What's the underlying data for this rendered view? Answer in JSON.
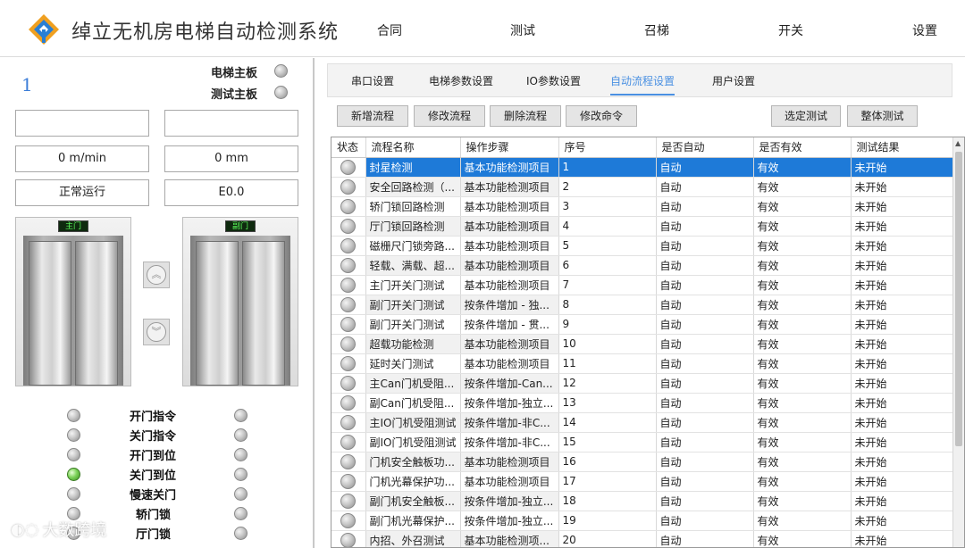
{
  "header": {
    "title": "绰立无机房电梯自动检测系统",
    "menu": [
      "合同",
      "测试",
      "召梯",
      "开关",
      "设置"
    ]
  },
  "left": {
    "elevator_number": "1",
    "boards": [
      {
        "label": "电梯主板",
        "state": "off"
      },
      {
        "label": "测试主板",
        "state": "off"
      }
    ],
    "fields": {
      "blank_left": "",
      "blank_right": "",
      "speed": "0 m/min",
      "position": "0 mm",
      "status": "正常运行",
      "error_code": "E0.0"
    },
    "cabins": [
      {
        "display": "主门",
        "name": "main"
      },
      {
        "display": "副门",
        "name": "sub"
      }
    ],
    "up_icon": "double-chevron-up-icon",
    "down_icon": "double-chevron-down-icon",
    "signals": [
      {
        "label": "开门指令",
        "left": "off",
        "right": "off"
      },
      {
        "label": "关门指令",
        "left": "off",
        "right": "off"
      },
      {
        "label": "开门到位",
        "left": "off",
        "right": "off"
      },
      {
        "label": "关门到位",
        "left": "on",
        "right": "off"
      },
      {
        "label": "慢速关门",
        "left": "off",
        "right": "off"
      },
      {
        "label": "轿门锁",
        "left": "off",
        "right": "off"
      },
      {
        "label": "厅门锁",
        "left": "off",
        "right": "off"
      }
    ],
    "watermark": "大数跨境"
  },
  "right": {
    "tabs": [
      "串口设置",
      "电梯参数设置",
      "IO参数设置",
      "自动流程设置",
      "用户设置"
    ],
    "active_tab": "自动流程设置",
    "buttons": [
      "新增流程",
      "修改流程",
      "删除流程",
      "修改命令",
      "选定测试",
      "整体测试"
    ],
    "columns": [
      "状态",
      "流程名称",
      "操作步骤",
      "序号",
      "是否自动",
      "是否有效",
      "测试结果"
    ],
    "rows": [
      [
        "",
        "封星检测",
        "基本功能检测项目",
        "1",
        "自动",
        "有效",
        "未开始"
      ],
      [
        "",
        "安全回路检测（...",
        "基本功能检测项目",
        "2",
        "自动",
        "有效",
        "未开始"
      ],
      [
        "",
        "轿门锁回路检测",
        "基本功能检测项目",
        "3",
        "自动",
        "有效",
        "未开始"
      ],
      [
        "",
        "厅门锁回路检测",
        "基本功能检测项目",
        "4",
        "自动",
        "有效",
        "未开始"
      ],
      [
        "",
        "磁栅尺门锁旁路...",
        "基本功能检测项目",
        "5",
        "自动",
        "有效",
        "未开始"
      ],
      [
        "",
        "轻载、满载、超...",
        "基本功能检测项目",
        "6",
        "自动",
        "有效",
        "未开始"
      ],
      [
        "",
        "主门开关门测试",
        "基本功能检测项目",
        "7",
        "自动",
        "有效",
        "未开始"
      ],
      [
        "",
        "副门开关门测试",
        "按条件增加 - 独...",
        "8",
        "自动",
        "有效",
        "未开始"
      ],
      [
        "",
        "副门开关门测试",
        "按条件增加 - 贯...",
        "9",
        "自动",
        "有效",
        "未开始"
      ],
      [
        "",
        "超载功能检测",
        "基本功能检测项目",
        "10",
        "自动",
        "有效",
        "未开始"
      ],
      [
        "",
        "延时关门测试",
        "基本功能检测项目",
        "11",
        "自动",
        "有效",
        "未开始"
      ],
      [
        "",
        "主Can门机受阻...",
        "按条件增加-Can...",
        "12",
        "自动",
        "有效",
        "未开始"
      ],
      [
        "",
        "副Can门机受阻...",
        "按条件增加-独立...",
        "13",
        "自动",
        "有效",
        "未开始"
      ],
      [
        "",
        "主IO门机受阻测试",
        "按条件增加-非C...",
        "14",
        "自动",
        "有效",
        "未开始"
      ],
      [
        "",
        "副IO门机受阻测试",
        "按条件增加-非C...",
        "15",
        "自动",
        "有效",
        "未开始"
      ],
      [
        "",
        "门机安全触板功...",
        "基本功能检测项目",
        "16",
        "自动",
        "有效",
        "未开始"
      ],
      [
        "",
        "门机光幕保护功...",
        "基本功能检测项目",
        "17",
        "自动",
        "有效",
        "未开始"
      ],
      [
        "",
        "副门机安全触板...",
        "按条件增加-独立...",
        "18",
        "自动",
        "有效",
        "未开始"
      ],
      [
        "",
        "副门机光幕保护...",
        "按条件增加-独立...",
        "19",
        "自动",
        "有效",
        "未开始"
      ],
      [
        "",
        "内招、外召测试",
        "基本功能检测项...",
        "20",
        "自动",
        "有效",
        "未开始"
      ]
    ],
    "selected_row": 0
  }
}
